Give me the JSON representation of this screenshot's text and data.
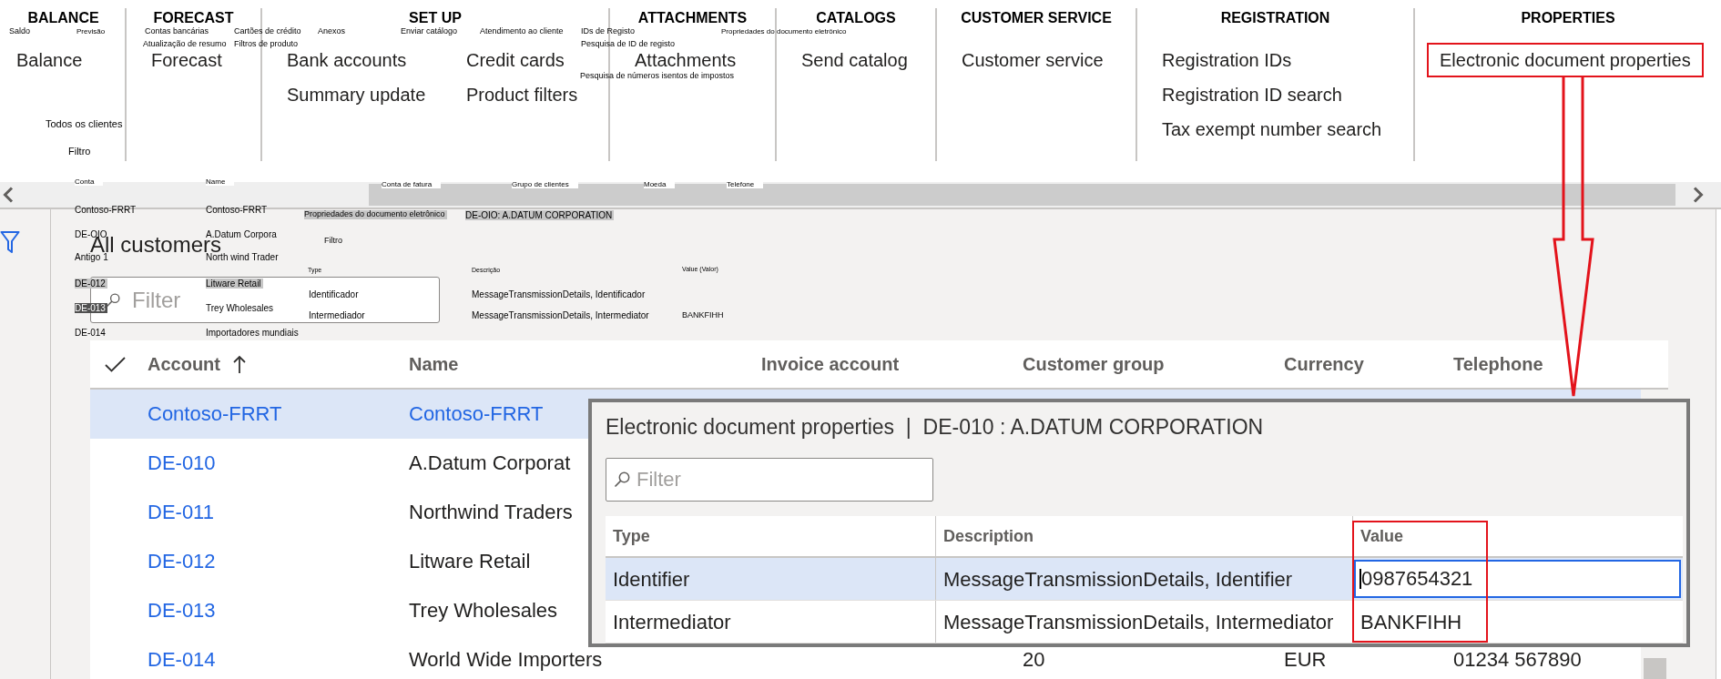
{
  "ribbon": {
    "groups": [
      {
        "title": "BALANCE",
        "columns": [
          [
            {
              "label": "Balance",
              "annotated": false
            }
          ]
        ]
      },
      {
        "title": "FORECAST",
        "columns": [
          [
            {
              "label": "Forecast",
              "annotated": false
            }
          ]
        ]
      },
      {
        "title": "SET UP",
        "columns": [
          [
            {
              "label": "Bank accounts",
              "annotated": false
            },
            {
              "label": "Summary update",
              "annotated": false
            }
          ],
          [
            {
              "label": "Credit cards",
              "annotated": false
            },
            {
              "label": "Product filters",
              "annotated": false
            }
          ]
        ]
      },
      {
        "title": "ATTACHMENTS",
        "columns": [
          [
            {
              "label": "Attachments",
              "annotated": false
            }
          ]
        ]
      },
      {
        "title": "CATALOGS",
        "columns": [
          [
            {
              "label": "Send catalog",
              "annotated": false
            }
          ]
        ]
      },
      {
        "title": "CUSTOMER SERVICE",
        "columns": [
          [
            {
              "label": "Customer service",
              "annotated": false
            }
          ]
        ]
      },
      {
        "title": "REGISTRATION",
        "columns": [
          [
            {
              "label": "Registration IDs",
              "annotated": false
            },
            {
              "label": "Registration ID search",
              "annotated": false
            },
            {
              "label": "Tax exempt number search",
              "annotated": false
            }
          ]
        ]
      },
      {
        "title": "PROPERTIES",
        "columns": [
          [
            {
              "label": "Electronic document properties",
              "annotated": true
            }
          ]
        ]
      }
    ],
    "overlay_labels": [
      {
        "text": "Saldo"
      },
      {
        "text": "Previsão"
      },
      {
        "text": "Contas bancárias"
      },
      {
        "text": "Cartões de crédito"
      },
      {
        "text": "Anexos"
      },
      {
        "text": "Enviar catálogo"
      },
      {
        "text": "Atendimento ao cliente"
      },
      {
        "text": "IDs de Registo"
      },
      {
        "text": "Propriedades do documento eletrônico"
      },
      {
        "text": "Atualização de resumo"
      },
      {
        "text": "Filtros de produto"
      },
      {
        "text": "Pesquisa de ID de registo"
      },
      {
        "text": "Pesquisa de números isentos de impostos"
      },
      {
        "text": "Todos os clientes"
      },
      {
        "text": "Filtro"
      }
    ]
  },
  "list_page": {
    "title": "All customers",
    "filter": {
      "placeholder": "Filter"
    },
    "overlay_labels": [
      {
        "text": "Conta",
        "kind": "tag"
      },
      {
        "text": "Name",
        "kind": "tag"
      },
      {
        "text": "Conta de fatura",
        "kind": "tag"
      },
      {
        "text": "Grupo de clientes",
        "kind": "tag"
      },
      {
        "text": "Moeda",
        "kind": "tag"
      },
      {
        "text": "Telefone",
        "kind": "tag"
      },
      {
        "text": "Contoso-FRRT",
        "kind": "plain"
      },
      {
        "text": "Contoso-FRRT",
        "kind": "plain"
      },
      {
        "text": "Propriedades do documento eletrônico",
        "kind": "highlight"
      },
      {
        "text": "DE-OIO: A.DATUM CORPORATION",
        "kind": "highlight"
      },
      {
        "text": "DE-OIO",
        "kind": "plain"
      },
      {
        "text": "A.Datum Corpora",
        "kind": "plain"
      },
      {
        "text": "Filtro",
        "kind": "plain"
      },
      {
        "text": "Antigo 1",
        "kind": "plain"
      },
      {
        "text": "North wind Trader",
        "kind": "plain"
      },
      {
        "text": "Type",
        "kind": "plain"
      },
      {
        "text": "Descrição",
        "kind": "plain"
      },
      {
        "text": "Value (Valor)",
        "kind": "plain"
      },
      {
        "text": "DE-012",
        "kind": "highlight"
      },
      {
        "text": "Litware Retail",
        "kind": "highlight"
      },
      {
        "text": "Identificador",
        "kind": "plain"
      },
      {
        "text": "MessageTransmissionDetails, Identificador",
        "kind": "plain"
      },
      {
        "text": "DE-013",
        "kind": "dark"
      },
      {
        "text": "Trey Wholesales",
        "kind": "plain"
      },
      {
        "text": "Intermediador",
        "kind": "plain"
      },
      {
        "text": "MessageTransmissionDetails, Intermediator",
        "kind": "plain"
      },
      {
        "text": "BANKFIHH",
        "kind": "plain"
      },
      {
        "text": "DE-014",
        "kind": "plain"
      },
      {
        "text": "Importadores mundiais",
        "kind": "plain"
      }
    ],
    "grid": {
      "columns": [
        {
          "label": "Account",
          "sorted": true
        },
        {
          "label": "Name",
          "sorted": false
        },
        {
          "label": "Invoice account",
          "sorted": false
        },
        {
          "label": "Customer group",
          "sorted": false
        },
        {
          "label": "Currency",
          "sorted": false
        },
        {
          "label": "Telephone",
          "sorted": false
        }
      ],
      "rows": [
        {
          "selected": true,
          "account": {
            "text": "Contoso-FRRT",
            "kind": "link"
          },
          "name": {
            "text": "Contoso-FRRT",
            "kind": "link"
          }
        },
        {
          "selected": false,
          "account": {
            "text": "DE-010",
            "kind": "link"
          },
          "name": {
            "text": "A.Datum Corporat",
            "kind": "text"
          }
        },
        {
          "selected": false,
          "account": {
            "text": "DE-011",
            "kind": "link"
          },
          "name": {
            "text": "Northwind Traders",
            "kind": "text"
          }
        },
        {
          "selected": false,
          "account": {
            "text": "DE-012",
            "kind": "link"
          },
          "name": {
            "text": "Litware Retail",
            "kind": "text"
          }
        },
        {
          "selected": false,
          "account": {
            "text": "DE-013",
            "kind": "link"
          },
          "name": {
            "text": "Trey Wholesales",
            "kind": "text"
          }
        },
        {
          "selected": false,
          "account": {
            "text": "DE-014",
            "kind": "link"
          },
          "name": {
            "text": "World Wide Importers",
            "kind": "text"
          },
          "customer_group": {
            "text": "20",
            "kind": "text"
          },
          "currency": {
            "text": "EUR",
            "kind": "text"
          },
          "telephone": {
            "text": "01234 567890",
            "kind": "text"
          }
        }
      ]
    }
  },
  "dialog": {
    "title": "Electronic document properties  |  DE-010 : A.DATUM CORPORATION",
    "filter": {
      "placeholder": "Filter"
    },
    "columns": [
      {
        "label": "Type",
        "annotated": false
      },
      {
        "label": "Description",
        "annotated": false
      },
      {
        "label": "Value",
        "annotated": true
      }
    ],
    "rows": [
      {
        "selected": true,
        "type": "Identifier",
        "description": "MessageTransmissionDetails, Identifier",
        "value": "0987654321",
        "editing": true
      },
      {
        "selected": false,
        "type": "Intermediator",
        "description": "MessageTransmissionDetails, Intermediator",
        "value": "BANKFIHH",
        "editing": false
      }
    ]
  }
}
